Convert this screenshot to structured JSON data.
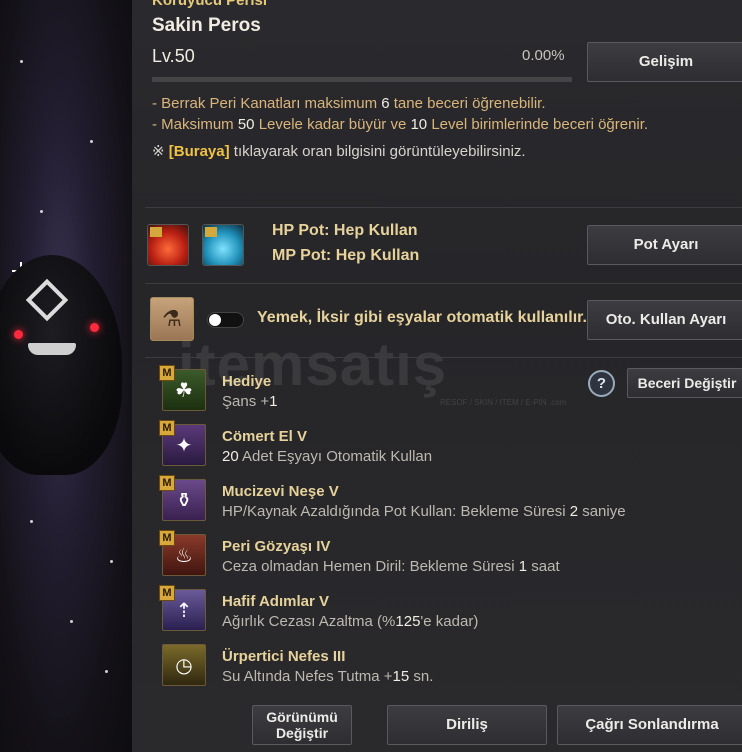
{
  "header": {
    "small_title": "Koruyucu Perisi",
    "pet_name": "Sakin Peros",
    "level_prefix": "Lv.",
    "level": "50",
    "exp_percent": "0.00%",
    "exp_fraction": 0.0,
    "upgrade_button": "Gelişim"
  },
  "info": {
    "line1_a": "- Berrak Peri Kanatları maksimum ",
    "line1_num": "6",
    "line1_b": " tane beceri öğrenebilir.",
    "line2_a": "- Maksimum ",
    "line2_num1": "50",
    "line2_b": " Levele kadar büyür ve ",
    "line2_num2": "10",
    "line2_c": " Level birimlerinde beceri öğrenir.",
    "line3_mark": "※ ",
    "line3_link": "[Buraya]",
    "line3_rest": " tıklayarak oran bilgisini görüntüleyebilirsiniz."
  },
  "potions": {
    "hp_text": "HP Pot: Hep Kullan",
    "mp_text": "MP Pot: Hep Kullan",
    "settings_button": "Pot Ayarı"
  },
  "auto_use": {
    "text": "Yemek, İksir gibi eşyalar otomatik kullanılır.",
    "settings_button": "Oto. Kullan Ayarı",
    "toggle_on": false
  },
  "skills": {
    "change_button": "Beceri Değiştir",
    "help_label": "?",
    "badge": "M",
    "list": [
      {
        "name": "Hediye",
        "desc_a": "Şans +",
        "desc_num": "1",
        "desc_b": ""
      },
      {
        "name": "Cömert El V",
        "desc_a": "",
        "desc_num": "20",
        "desc_b": " Adet Eşyayı Otomatik Kullan"
      },
      {
        "name": "Mucizevi Neşe V",
        "desc_a": "HP/Kaynak Azaldığında Pot Kullan: Bekleme Süresi ",
        "desc_num": "2",
        "desc_b": " saniye"
      },
      {
        "name": "Peri Gözyaşı IV",
        "desc_a": "Ceza olmadan Hemen Diril: Bekleme Süresi ",
        "desc_num": "1",
        "desc_b": " saat"
      },
      {
        "name": "Hafif Adımlar V",
        "desc_a": "Ağırlık Cezası Azaltma (%",
        "desc_num": "125",
        "desc_b": "'e kadar)"
      },
      {
        "name": "Ürpertici Nefes III",
        "desc_a": "Su Altında Nefes Tutma +",
        "desc_num": "15",
        "desc_b": " sn."
      }
    ]
  },
  "footer": {
    "appearance_button": "Görünümü Değiştir",
    "revive_button": "Diriliş",
    "dismiss_button": "Çağrı Sonlandırma"
  },
  "watermark": {
    "text": "itemsatış",
    "sub": "RESOF / SKIN / ITEM / E-PIN .com"
  },
  "colors": {
    "gold_text": "#e6d29a",
    "highlight": "#f0c244",
    "panel_bg": "#2a2a2e"
  }
}
